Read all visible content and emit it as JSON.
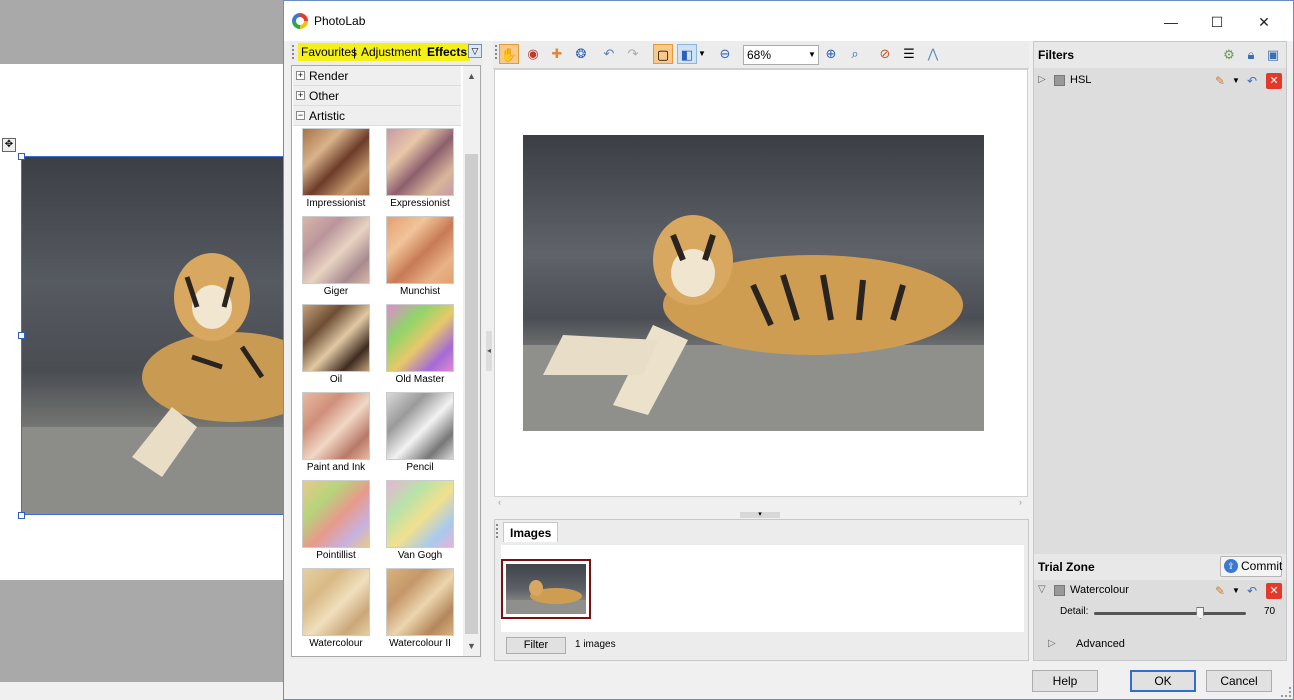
{
  "window": {
    "title": "PhotoLab",
    "controls": {
      "minimize": "—",
      "maximize": "☐",
      "close": "✕"
    }
  },
  "left_panel": {
    "tabs": [
      {
        "label": "Favourites",
        "highlighted": true
      },
      {
        "label": "Adjustment",
        "highlighted": true
      },
      {
        "label": "Effects",
        "highlighted": true,
        "active": true
      }
    ],
    "tab_separator": "|",
    "categories": [
      {
        "label": "Render",
        "expander": "+"
      },
      {
        "label": "Other",
        "expander": "+"
      },
      {
        "label": "Artistic",
        "expander": "−"
      }
    ],
    "effects": [
      {
        "label": "Impressionist",
        "colors": [
          "#a8734a",
          "#d8b38a",
          "#6d3b2a",
          "#c79a6c"
        ]
      },
      {
        "label": "Expressionist",
        "colors": [
          "#c79aa5",
          "#e8c7a8",
          "#8d5f6e",
          "#d9b59a"
        ]
      },
      {
        "label": "Giger",
        "colors": [
          "#d8b7a8",
          "#b9959c",
          "#e8d3c2",
          "#a78a8f"
        ]
      },
      {
        "label": "Munchist",
        "colors": [
          "#e3a072",
          "#f1c49a",
          "#c77a55",
          "#e9b287"
        ]
      },
      {
        "label": "Oil",
        "colors": [
          "#c4a07a",
          "#6d4e35",
          "#e2c8a4",
          "#3e2c22"
        ]
      },
      {
        "label": "Old Master",
        "colors": [
          "#e08ad2",
          "#8fd56b",
          "#e8c86a",
          "#a46ad6"
        ]
      },
      {
        "label": "Paint and Ink",
        "colors": [
          "#e8b9a2",
          "#cf8f7a",
          "#f1d7c6",
          "#b87968"
        ]
      },
      {
        "label": "Pencil",
        "colors": [
          "#d9d9d9",
          "#9a9a9a",
          "#f2f2f2",
          "#777777"
        ]
      },
      {
        "label": "Pointillist",
        "colors": [
          "#e7c98b",
          "#b6d47c",
          "#e79a8a",
          "#c6b2e0"
        ]
      },
      {
        "label": "Van Gogh",
        "colors": [
          "#e9b2d8",
          "#b7e3a8",
          "#f1e08e",
          "#a8c9ee"
        ]
      },
      {
        "label": "Watercolour",
        "colors": [
          "#e6cfa2",
          "#d8b985",
          "#f0dfbd",
          "#caa77a"
        ]
      },
      {
        "label": "Watercolour II",
        "colors": [
          "#d9b27c",
          "#c4976a",
          "#ecd5ad",
          "#b3875d"
        ]
      }
    ]
  },
  "toolbar": {
    "zoom_value": "68%",
    "icons": [
      "hand-icon",
      "red-eye-icon",
      "bandage-icon",
      "clone-icon",
      "undo-icon",
      "redo-icon",
      "crop-frame-icon",
      "compare-icon",
      "dropdown-icon",
      "zoom-out-icon",
      "zoom-in-icon",
      "zoom-fit-icon",
      "color-pick-icon",
      "levels-icon",
      "histogram-icon"
    ]
  },
  "images_panel": {
    "title": "Images",
    "filter_button": "Filter",
    "count_text": "1 images"
  },
  "filters_panel": {
    "title": "Filters",
    "items": [
      {
        "label": "HSL"
      }
    ]
  },
  "trial_zone": {
    "title": "Trial Zone",
    "commit_label": "Commit",
    "filter_label": "Watercolour",
    "detail_label": "Detail:",
    "detail_value": "70",
    "detail_fraction": 0.7,
    "advanced_label": "Advanced"
  },
  "buttons": {
    "help": "Help",
    "ok": "OK",
    "cancel": "Cancel"
  },
  "colors": {
    "tab_highlight": "#f5ef1a",
    "selection_border": "#7a1010",
    "close_red": "#e2392a",
    "accent_blue": "#2f6fd0"
  }
}
